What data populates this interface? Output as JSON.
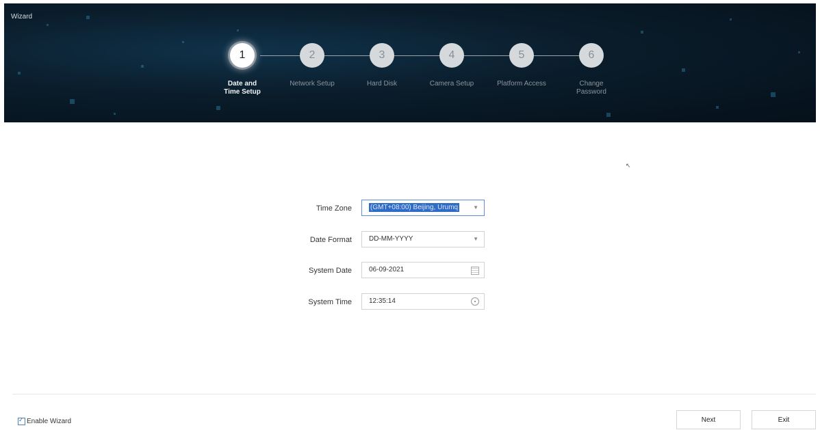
{
  "window": {
    "title": "Wizard"
  },
  "steps": [
    {
      "number": "1",
      "label": "Date and Time Setup",
      "active": true
    },
    {
      "number": "2",
      "label": "Network Setup",
      "active": false
    },
    {
      "number": "3",
      "label": "Hard Disk",
      "active": false
    },
    {
      "number": "4",
      "label": "Camera Setup",
      "active": false
    },
    {
      "number": "5",
      "label": "Platform Access",
      "active": false
    },
    {
      "number": "6",
      "label": "Change Password",
      "active": false
    }
  ],
  "form": {
    "time_zone": {
      "label": "Time Zone",
      "value": "(GMT+08:00) Beijing, Urumq"
    },
    "date_format": {
      "label": "Date Format",
      "value": "DD-MM-YYYY"
    },
    "system_date": {
      "label": "System Date",
      "value": "06-09-2021"
    },
    "system_time": {
      "label": "System Time",
      "value": "12:35:14"
    }
  },
  "footer": {
    "enable_wizard": {
      "label": "Enable Wizard",
      "checked": true
    },
    "next_label": "Next",
    "exit_label": "Exit"
  },
  "colors": {
    "accent": "#2f6cc8",
    "banner_bg": "#0a1c2a"
  }
}
